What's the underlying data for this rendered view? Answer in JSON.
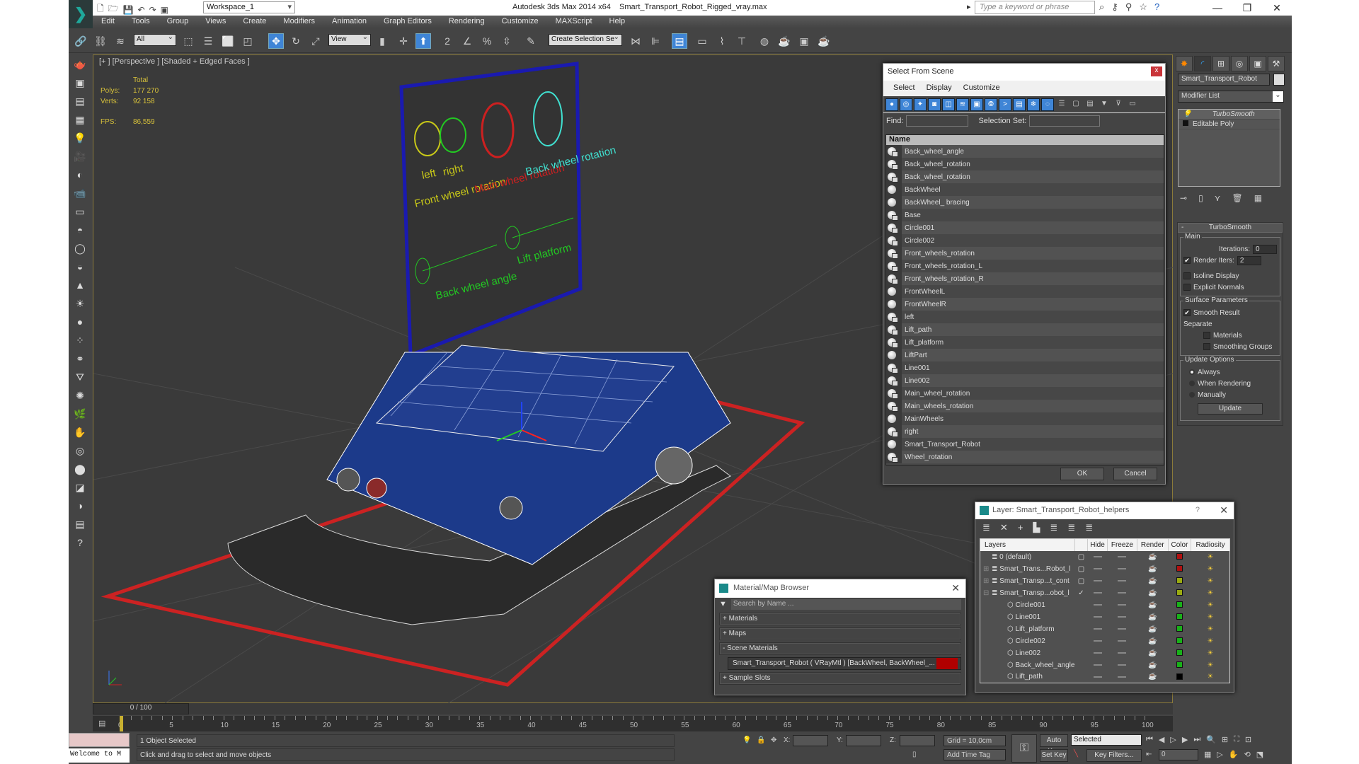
{
  "app": {
    "title": "Autodesk 3ds Max  2014 x64",
    "file": "Smart_Transport_Robot_Rigged_vray.max",
    "workspace": "Workspace_1",
    "search_placeholder": "Type a keyword or phrase"
  },
  "menu": [
    "Edit",
    "Tools",
    "Group",
    "Views",
    "Create",
    "Modifiers",
    "Animation",
    "Graph Editors",
    "Rendering",
    "Customize",
    "MAXScript",
    "Help"
  ],
  "toolbar": {
    "selection_filter": "All",
    "reference_coord": "View",
    "named_selection": "Create Selection Se"
  },
  "viewport": {
    "label": "[+ ] [Perspective ] [Shaded + Edged Faces ]",
    "stats_header": "Total",
    "polys_label": "Polys:",
    "polys": "177 270",
    "verts_label": "Verts:",
    "verts": "92 158",
    "fps_label": "FPS:",
    "fps": "86,559",
    "rig_labels": {
      "left": "left",
      "right": "right",
      "front": "Front wheel rotation",
      "main": "Main wheel rotation",
      "back": "Back wheel rotation",
      "angle": "Back wheel angle",
      "lift": "Lift platform"
    }
  },
  "command_panel": {
    "object_name": "Smart_Transport_Robot",
    "modifier_list": "Modifier List",
    "stack": [
      "TurboSmooth",
      "Editable Poly"
    ],
    "rollout_title": "TurboSmooth",
    "main_group": "Main",
    "iterations_label": "Iterations:",
    "iterations": "0",
    "render_iters_label": "Render Iters:",
    "render_iters": "2",
    "render_iters_checked": true,
    "isoline_label": "Isoline Display",
    "isoline_checked": false,
    "explicit_label": "Explicit Normals",
    "explicit_checked": false,
    "surface_group": "Surface Parameters",
    "smooth_result_label": "Smooth Result",
    "smooth_result_checked": true,
    "separate_label": "Separate",
    "materials_label": "Materials",
    "smoothing_groups_label": "Smoothing Groups",
    "update_group": "Update Options",
    "update_options": [
      "Always",
      "When Rendering",
      "Manually"
    ],
    "update_selected": "Always",
    "update_button": "Update"
  },
  "select_from_scene": {
    "title": "Select From Scene",
    "close": "x",
    "menu": [
      "Select",
      "Display",
      "Customize"
    ],
    "find_label": "Find:",
    "selection_set_label": "Selection Set:",
    "column": "Name",
    "items": [
      {
        "name": "Back_wheel_angle",
        "type": "shape"
      },
      {
        "name": "Back_wheel_rotation",
        "type": "shape"
      },
      {
        "name": "Back_wheel_rotation",
        "type": "shape"
      },
      {
        "name": "BackWheel",
        "type": "geometry"
      },
      {
        "name": "BackWheel_ bracing",
        "type": "geometry"
      },
      {
        "name": "Base",
        "type": "shape"
      },
      {
        "name": "Circle001",
        "type": "shape"
      },
      {
        "name": "Circle002",
        "type": "shape"
      },
      {
        "name": "Front_wheels_rotation",
        "type": "shape"
      },
      {
        "name": "Front_wheels_rotation_L",
        "type": "shape"
      },
      {
        "name": "Front_wheels_rotation_R",
        "type": "shape"
      },
      {
        "name": "FrontWheelL",
        "type": "geometry"
      },
      {
        "name": "FrontWheelR",
        "type": "geometry"
      },
      {
        "name": "left",
        "type": "shape"
      },
      {
        "name": "Lift_path",
        "type": "shape"
      },
      {
        "name": "Lift_platform",
        "type": "shape"
      },
      {
        "name": "LiftPart",
        "type": "geometry"
      },
      {
        "name": "Line001",
        "type": "shape"
      },
      {
        "name": "Line002",
        "type": "shape"
      },
      {
        "name": "Main_wheel_rotation",
        "type": "shape"
      },
      {
        "name": "Main_wheels_rotation",
        "type": "shape"
      },
      {
        "name": "MainWheels",
        "type": "geometry"
      },
      {
        "name": "right",
        "type": "shape"
      },
      {
        "name": "Smart_Transport_Robot",
        "type": "geometry"
      },
      {
        "name": "Wheel_rotation",
        "type": "shape"
      }
    ],
    "ok": "OK",
    "cancel": "Cancel"
  },
  "layer_dialog": {
    "title": "Layer: Smart_Transport_Robot_helpers",
    "help": "?",
    "columns": [
      "Layers",
      "",
      "Hide",
      "Freeze",
      "Render",
      "Color",
      "Radiosity"
    ],
    "rows": [
      {
        "name": "0 (default)",
        "indent": 0,
        "expander": "",
        "current": false,
        "color": "#b01010"
      },
      {
        "name": "Smart_Trans...Robot_l",
        "indent": 0,
        "expander": "+",
        "current": false,
        "color": "#b01010"
      },
      {
        "name": "Smart_Transp...t_cont",
        "indent": 0,
        "expander": "+",
        "current": false,
        "color": "#9aaa10"
      },
      {
        "name": "Smart_Transp...obot_l",
        "indent": 0,
        "expander": "-",
        "current": true,
        "color": "#9aaa10"
      },
      {
        "name": "Circle001",
        "indent": 1,
        "color": "#18b018"
      },
      {
        "name": "Line001",
        "indent": 1,
        "color": "#18b018"
      },
      {
        "name": "Lift_platform",
        "indent": 1,
        "color": "#18b018"
      },
      {
        "name": "Circle002",
        "indent": 1,
        "color": "#18b018"
      },
      {
        "name": "Line002",
        "indent": 1,
        "color": "#18b018"
      },
      {
        "name": "Back_wheel_angle",
        "indent": 1,
        "color": "#18b018"
      },
      {
        "name": "Lift_path",
        "indent": 1,
        "color": "#000000"
      }
    ]
  },
  "material_browser": {
    "title": "Material/Map Browser",
    "search_placeholder": "Search by Name ...",
    "sections": [
      "+ Materials",
      "+ Maps",
      "- Scene Materials"
    ],
    "scene_item": "Smart_Transport_Robot  ( VRayMtl )  [BackWheel, BackWheel_...",
    "last_section": "+ Sample Slots"
  },
  "timeline": {
    "slider": "0 / 100",
    "ticks": [
      0,
      5,
      10,
      15,
      20,
      25,
      30,
      35,
      40,
      45,
      50,
      55,
      60,
      65,
      70,
      75,
      80,
      85,
      90,
      95,
      100
    ]
  },
  "status": {
    "maxscript": "Welcome to M",
    "selection": "1 Object Selected",
    "prompt": "Click and drag to select and move objects",
    "x_label": "X:",
    "y_label": "Y:",
    "z_label": "Z:",
    "grid": "Grid = 10,0cm",
    "add_time_tag": "Add Time Tag",
    "auto_key": "Auto Key",
    "set_key": "Set Key",
    "key_mode": "Selected",
    "key_filters": "Key Filters...",
    "frame": "0"
  }
}
